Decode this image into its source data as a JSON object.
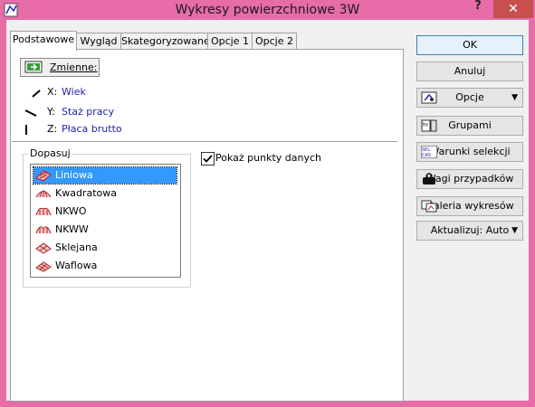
{
  "window": {
    "title": "Wykresy powierzchniowe 3W",
    "help": "?",
    "close": "✕"
  },
  "tabs": [
    {
      "label": "Podstawowe"
    },
    {
      "label": "Wygląd"
    },
    {
      "label": "Skategoryzowane"
    },
    {
      "label": "Opcje 1"
    },
    {
      "label": "Opcje 2"
    }
  ],
  "variables_button": "Zmienne:",
  "variables": [
    {
      "axis": "X:",
      "name": "Wiek"
    },
    {
      "axis": "Y:",
      "name": "Staż pracy"
    },
    {
      "axis": "Z:",
      "name": "Płaca brutto"
    }
  ],
  "fit_group": {
    "label": "Dopasuj",
    "items": [
      "Liniowa",
      "Kwadratowa",
      "NKWO",
      "NKWW",
      "Sklejana",
      "Waflowa"
    ],
    "selected": "Liniowa"
  },
  "show_points": {
    "label": "Pokaż punkty danych",
    "checked": true
  },
  "right_buttons": {
    "ok": "OK",
    "cancel": "Anuluj",
    "options": "Opcje",
    "groups": "Grupami",
    "select_cases": "Warunki selekcji",
    "weights": "Wagi przypadków",
    "gallery": "Galeria wykresów",
    "update": "Aktualizuj: Auto"
  },
  "colors": {
    "titlebar": "#e76ca8",
    "close": "#c7504f",
    "selection": "#3399ff",
    "link": "#2323a8"
  }
}
